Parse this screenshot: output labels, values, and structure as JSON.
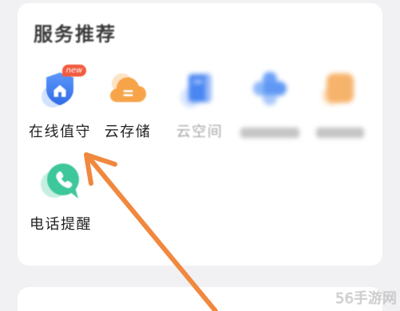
{
  "section": {
    "title": "服务推荐"
  },
  "services": [
    {
      "label": "在线值守",
      "badge": "new",
      "icon": "shield-home-icon",
      "color": "#3f7ff0"
    },
    {
      "label": "云存储",
      "icon": "cloud-icon",
      "color": "#f7a449"
    },
    {
      "label": "云空间",
      "icon": "book-icon",
      "color": "#4a86f2"
    },
    {
      "icon": "cluster-icon",
      "color": "#6aa0f6"
    },
    {
      "icon": "app-icon",
      "color": "#f6b36c"
    }
  ],
  "more_services": [
    {
      "label": "电话提醒",
      "icon": "phone-icon",
      "color": "#3dc79b"
    }
  ],
  "watermark": "56手游网",
  "colors": {
    "background": "#f1f1f3",
    "card": "#ffffff",
    "arrow": "#f0883e",
    "badge": "#f25a3f"
  }
}
